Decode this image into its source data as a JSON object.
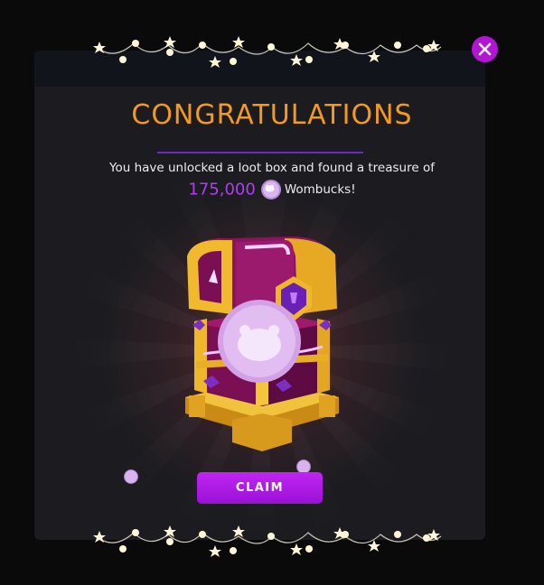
{
  "dialog": {
    "title": "CONGRATULATIONS",
    "message": "You have unlocked a loot box and found a treasure of",
    "reward_amount": "175,000",
    "currency_name": "Wombucks!",
    "currency_icon": "wombat-coin-icon",
    "claim_label": "CLAIM",
    "close_icon": "close-icon",
    "chest_icon": "treasure-chest-icon"
  },
  "colors": {
    "title": "#f39a1e",
    "accent": "#b013da",
    "amount": "#b13df2",
    "modal_bg": "#1c1c20",
    "page_bg": "#0a0a0b"
  }
}
